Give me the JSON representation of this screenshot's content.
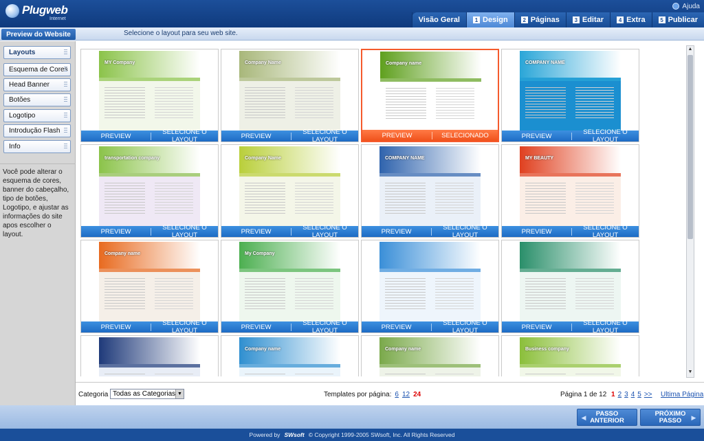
{
  "app": {
    "name": "Plugweb",
    "sub": "Internet",
    "help": "Ajuda"
  },
  "tabs": [
    {
      "num": "",
      "label": "Visão Geral",
      "active": false
    },
    {
      "num": "1",
      "label": "Design",
      "active": true
    },
    {
      "num": "2",
      "label": "Páginas",
      "active": false
    },
    {
      "num": "3",
      "label": "Editar",
      "active": false
    },
    {
      "num": "4",
      "label": "Extra",
      "active": false
    },
    {
      "num": "5",
      "label": "Publicar",
      "active": false
    }
  ],
  "subbar": {
    "preview_label": "Preview do Website",
    "message": "Selecione o layout para seu web site."
  },
  "sidebar": {
    "items": [
      "Layouts",
      "Esquema de Cores",
      "Head Banner",
      "Botões",
      "Logotipo",
      "Introdução Flash",
      "Info"
    ],
    "description": "Você pode alterar o esquema de cores, banner do cabeçalho, tipo de botões, Logotipo, e ajustar as informações do site apos escolher o layout."
  },
  "card_labels": {
    "preview": "PREVIEW",
    "select": "SELECIONE O LAYOUT",
    "selected": "SELECIONADO"
  },
  "templates": [
    {
      "name": "template-1",
      "text": "MY Company",
      "accent": "#8bc34a",
      "bg": "#f2f7ea",
      "selected": false
    },
    {
      "name": "template-2",
      "text": "Company Name",
      "accent": "#a8b77a",
      "bg": "#eef0e6",
      "selected": false
    },
    {
      "name": "template-3",
      "text": "Company name",
      "accent": "#5fa01e",
      "bg": "#ffffff",
      "selected": true
    },
    {
      "name": "template-4",
      "text": "COMPANY NAME",
      "accent": "#2aa6d8",
      "bg": "#1b8fd0",
      "selected": false
    },
    {
      "name": "template-5",
      "text": "transportation company",
      "accent": "#8bc34a",
      "bg": "#efe8f5",
      "selected": false
    },
    {
      "name": "template-6",
      "text": "Company Name",
      "accent": "#b9cf3a",
      "bg": "#f4f6e8",
      "selected": false
    },
    {
      "name": "template-7",
      "text": "COMPANY NAME",
      "accent": "#2f63ad",
      "bg": "#eaf0f8",
      "selected": false
    },
    {
      "name": "template-8",
      "text": "MY BEAUTY",
      "accent": "#e0401f",
      "bg": "#fbeee6",
      "selected": false
    },
    {
      "name": "template-9",
      "text": "Company name",
      "accent": "#e86a1f",
      "bg": "#f5efe8",
      "selected": false
    },
    {
      "name": "template-10",
      "text": "My Company",
      "accent": "#4caf50",
      "bg": "#eef7ee",
      "selected": false
    },
    {
      "name": "template-11",
      "text": "",
      "accent": "#3a8fd8",
      "bg": "#eef5fc",
      "selected": false
    },
    {
      "name": "template-12",
      "text": "",
      "accent": "#2a8f6a",
      "bg": "#edf6f2",
      "selected": false
    },
    {
      "name": "template-13",
      "text": "",
      "accent": "#1f3a7a",
      "bg": "#e8edf6",
      "selected": false
    },
    {
      "name": "template-14",
      "text": "Company name",
      "accent": "#2f8fd0",
      "bg": "#eaf4fb",
      "selected": false
    },
    {
      "name": "template-15",
      "text": "Company name",
      "accent": "#7aa94a",
      "bg": "#eef3e8",
      "selected": false
    },
    {
      "name": "template-16",
      "text": "Business company",
      "accent": "#8bbf3a",
      "bg": "#f1f7e8",
      "selected": false
    }
  ],
  "footer": {
    "category_label": "Categoria",
    "category_value": "Todas as Categorias",
    "per_page_label": "Templates por página:",
    "per_page_options": [
      "6",
      "12"
    ],
    "per_page_current": "24",
    "page_info": "Página 1 de 12",
    "pages": [
      "1",
      "2",
      "3",
      "4",
      "5",
      ">>"
    ],
    "last_page": "Ultima Página"
  },
  "nav": {
    "prev_line1": "PASSO",
    "prev_line2": "ANTERIOR",
    "next_line1": "PRÓXIMO",
    "next_line2": "PASSO"
  },
  "bottom": {
    "powered": "Powered by",
    "brand": "SWsoft",
    "copyright": "© Copyright 1999-2005 SWsoft, Inc. All Rights Reserved"
  }
}
